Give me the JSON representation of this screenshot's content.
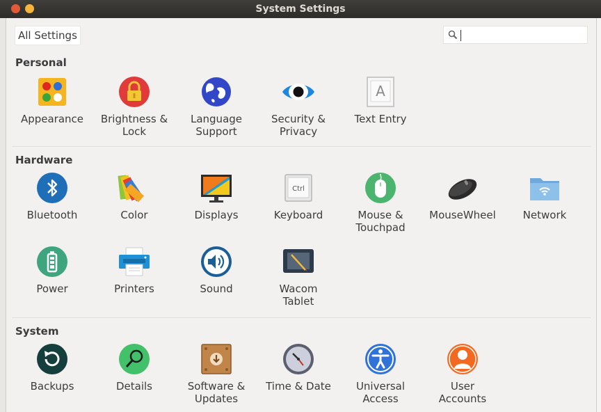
{
  "window": {
    "title": "System Settings"
  },
  "toolbar": {
    "all_settings_label": "All Settings",
    "search_value": ""
  },
  "sections": {
    "personal": {
      "title": "Personal",
      "items": [
        {
          "label": "Appearance",
          "icon": "appearance-icon"
        },
        {
          "label": "Brightness &\nLock",
          "icon": "brightness-lock-icon"
        },
        {
          "label": "Language\nSupport",
          "icon": "language-globe-icon"
        },
        {
          "label": "Security &\nPrivacy",
          "icon": "security-eye-icon"
        },
        {
          "label": "Text Entry",
          "icon": "text-entry-icon"
        }
      ]
    },
    "hardware": {
      "title": "Hardware",
      "items": [
        {
          "label": "Bluetooth",
          "icon": "bluetooth-icon"
        },
        {
          "label": "Color",
          "icon": "color-swatches-icon"
        },
        {
          "label": "Displays",
          "icon": "displays-monitor-icon"
        },
        {
          "label": "Keyboard",
          "icon": "keyboard-ctrl-key-icon"
        },
        {
          "label": "Mouse &\nTouchpad",
          "icon": "mouse-icon"
        },
        {
          "label": "MouseWheel",
          "icon": "wireless-mouse-icon"
        },
        {
          "label": "Network",
          "icon": "network-folder-icon"
        },
        {
          "label": "Power",
          "icon": "battery-icon"
        },
        {
          "label": "Printers",
          "icon": "printer-icon"
        },
        {
          "label": "Sound",
          "icon": "speaker-icon"
        },
        {
          "label": "Wacom\nTablet",
          "icon": "tablet-pen-icon"
        }
      ]
    },
    "system": {
      "title": "System",
      "items": [
        {
          "label": "Backups",
          "icon": "backup-icon"
        },
        {
          "label": "Details",
          "icon": "magnifier-details-icon"
        },
        {
          "label": "Software &\nUpdates",
          "icon": "software-package-icon"
        },
        {
          "label": "Time & Date",
          "icon": "clock-icon"
        },
        {
          "label": "Universal\nAccess",
          "icon": "universal-access-icon"
        },
        {
          "label": "User\nAccounts",
          "icon": "user-accounts-icon"
        }
      ]
    }
  }
}
